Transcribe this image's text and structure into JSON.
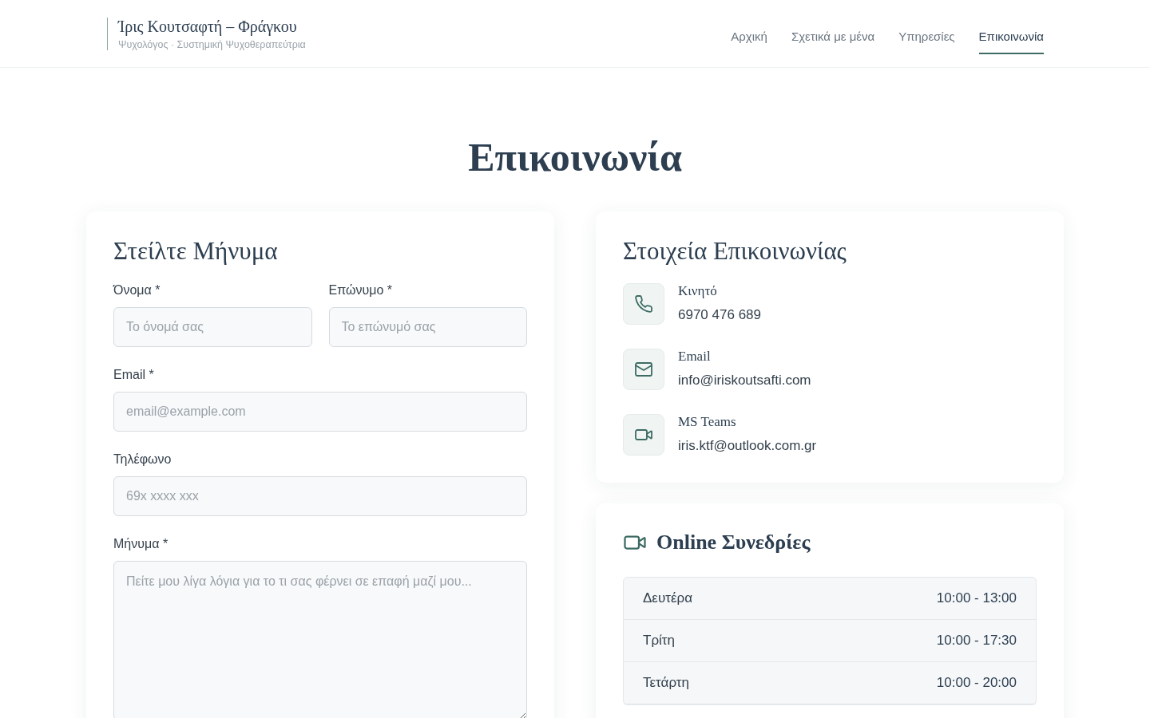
{
  "header": {
    "brand": "Ίρις Κουτσαφτή – Φράγκου",
    "tagline": "Ψυχολόγος · Συστημική Ψυχοθεραπεύτρια",
    "nav": [
      {
        "label": "Αρχική",
        "selected": false
      },
      {
        "label": "Σχετικά με μένα",
        "selected": false
      },
      {
        "label": "Υπηρεσίες",
        "selected": false
      },
      {
        "label": "Επικοινωνία",
        "selected": true
      }
    ]
  },
  "page_title": "Επικοινωνία",
  "form": {
    "title": "Στείλτε Μήνυμα",
    "rows": [
      [
        {
          "kind": "input",
          "label": "Όνομα *",
          "placeholder": "Το όνομά σας"
        },
        {
          "kind": "input",
          "label": "Επώνυμο *",
          "placeholder": "Το επώνυμό σας"
        }
      ],
      [
        {
          "kind": "input",
          "label": "Email *",
          "placeholder": "email@example.com"
        }
      ],
      [
        {
          "kind": "input",
          "label": "Τηλέφωνο",
          "placeholder": "69x xxxx xxx"
        }
      ],
      [
        {
          "kind": "textarea",
          "label": "Μήνυμα *",
          "placeholder": "Πείτε μου λίγα λόγια για το τι σας φέρνει σε επαφή μαζί μου..."
        }
      ]
    ]
  },
  "contact": {
    "title": "Στοιχεία Επικοινωνίας",
    "items": [
      {
        "kind": "phone",
        "label": "Κινητό",
        "value": "6970 476 689"
      },
      {
        "kind": "email",
        "label": "Email",
        "value": "info@iriskoutsafti.com"
      },
      {
        "kind": "video",
        "label": "MS Teams",
        "value": "iris.ktf@outlook.com.gr"
      }
    ]
  },
  "online": {
    "title": "Online Συνεδρίες",
    "schedule": [
      {
        "day": "Δευτέρα",
        "hours": "10:00 - 13:00"
      },
      {
        "day": "Τρίτη",
        "hours": "10:00 - 17:30"
      },
      {
        "day": "Τετάρτη",
        "hours": "10:00 - 20:00"
      }
    ]
  }
}
